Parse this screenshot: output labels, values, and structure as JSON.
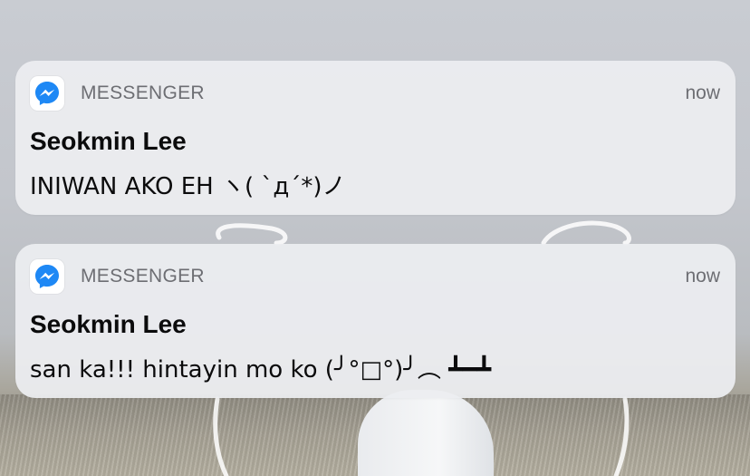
{
  "notifications": [
    {
      "app_icon": "messenger-icon",
      "app_name": "MESSENGER",
      "time": "now",
      "sender": "Seokmin Lee",
      "message": "INIWAN AKO EH ヽ( `д´*)ノ"
    },
    {
      "app_icon": "messenger-icon",
      "app_name": "MESSENGER",
      "time": "now",
      "sender": "Seokmin Lee",
      "message": "san ka!!! hintayin mo ko (╯°□°)╯︵ ┻━┻"
    }
  ],
  "colors": {
    "messenger_blue": "#1e88f5",
    "card_background": "#ecedf0",
    "secondary_text": "#6d6e73",
    "primary_text": "#0b0b0c"
  }
}
